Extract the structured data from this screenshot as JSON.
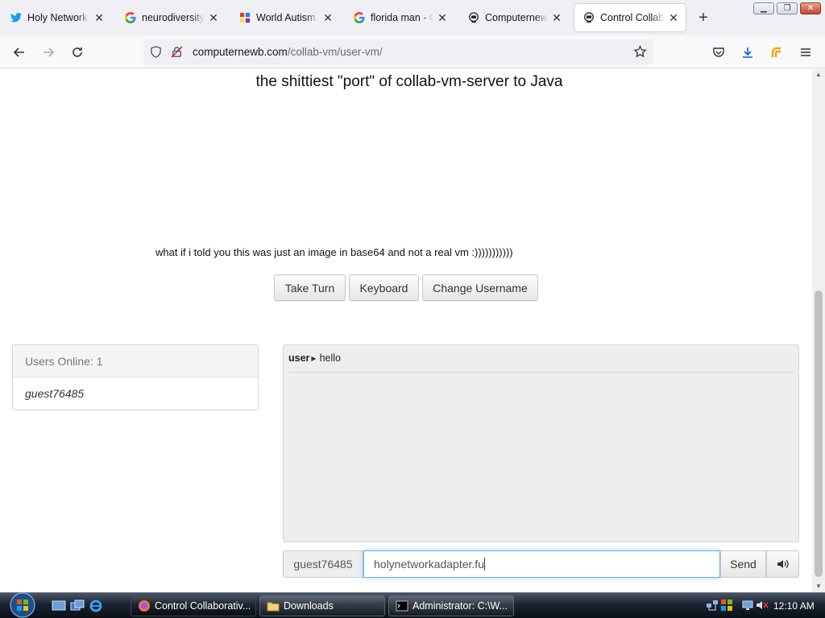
{
  "browser": {
    "tabs": [
      {
        "title": "Holy Network Adapter",
        "icon": "twitter-icon"
      },
      {
        "title": "neurodiversity - Google",
        "icon": "google-icon"
      },
      {
        "title": "World Autism Awareness",
        "icon": "puzzle-icon"
      },
      {
        "title": "florida man - Google",
        "icon": "google-icon"
      },
      {
        "title": "Computernewb",
        "icon": "computernewb-icon"
      },
      {
        "title": "Control Collaborative",
        "icon": "computernewb-icon"
      }
    ],
    "active_tab": 5,
    "new_tab_label": "+",
    "url_domain": "computernewb.com",
    "url_path": "/collab-vm/user-vm/"
  },
  "page": {
    "heading": "the shittiest \"port\" of collab-vm-server to Java",
    "caption": "what if i told you this was just an image in base64 and not a real vm :)))))))))))",
    "buttons": {
      "take_turn": "Take Turn",
      "keyboard": "Keyboard",
      "change_username": "Change Username"
    },
    "users_panel": {
      "header": "Users Online: 1",
      "users": [
        "guest76485"
      ]
    },
    "chat": {
      "messages": [
        {
          "user": "user",
          "text": "hello"
        }
      ]
    },
    "chat_input": {
      "username": "guest76485",
      "value": "holynetworkadapter.fu",
      "send_label": "Send"
    }
  },
  "taskbar": {
    "items": [
      {
        "label": "Control Collaborativ...",
        "icon": "firefox-icon",
        "active": true
      },
      {
        "label": "Downloads",
        "icon": "folder-icon",
        "active": false
      },
      {
        "label": "Administrator: C:\\W...",
        "icon": "cmd-icon",
        "active": false
      }
    ],
    "clock": "12:10 AM"
  },
  "colors": {
    "accent_focus": "#66afe9",
    "twitter": "#1d9bf0",
    "firefox": "#ff7139"
  }
}
